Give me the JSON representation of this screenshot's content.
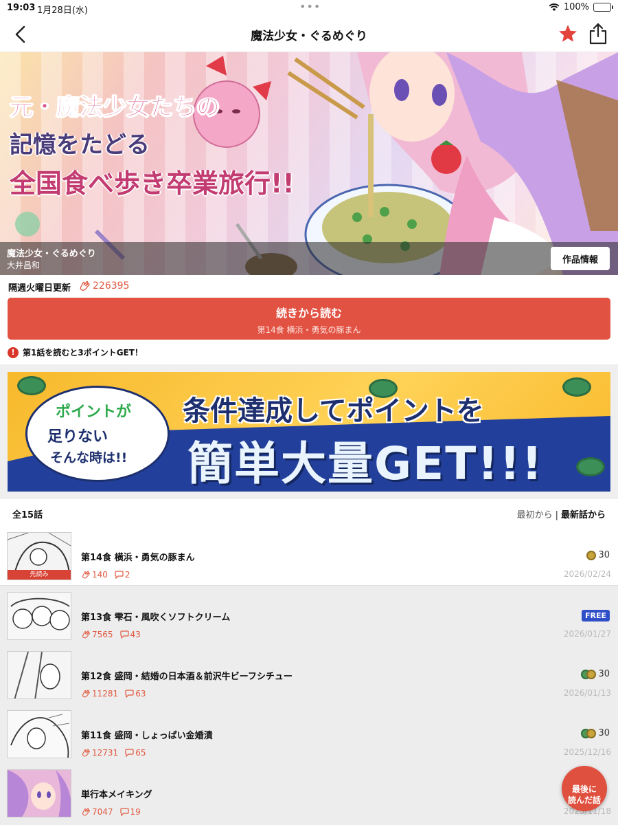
{
  "status": {
    "time": "19:03",
    "date": "1月28日(水)",
    "battery": "100%"
  },
  "nav": {
    "title": "魔法少女・ぐるめぐり"
  },
  "hero": {
    "catch_line1": "元・魔法少女たちの",
    "catch_line2": "記憶をたどる",
    "catch_line3": "全国食べ歩き卒業旅行!!",
    "title": "魔法少女・ぐるめぐり",
    "author": "大井昌和",
    "info_button": "作品情報"
  },
  "update": {
    "schedule": "隔週火曜日更新",
    "likes": "226395"
  },
  "continue": {
    "label": "続きから読む",
    "episode": "第14食 横浜・勇気の豚まん"
  },
  "notice": "第1話を読むと3ポイントGET！",
  "banner": {
    "bubble1": "ポイントが",
    "bubble2": "足りない",
    "bubble3": "そんな時は!!",
    "headline1": "条件達成してポイントを",
    "headline2": "簡単大量GET!!!"
  },
  "list": {
    "count": "全15話",
    "sort_oldest": "最初から",
    "sort_sep": "|",
    "sort_newest": "最新話から"
  },
  "episodes": [
    {
      "title": "第14食 横浜・勇気の豚まん",
      "likes": "140",
      "comments": "2",
      "price": "30",
      "date": "2026/02/24",
      "tag": "先読み"
    },
    {
      "title": "第13食 雫石・風吹くソフトクリーム",
      "likes": "7565",
      "comments": "43",
      "price": "FREE",
      "date": "2026/01/27"
    },
    {
      "title": "第12食 盛岡・結婚の日本酒＆前沢牛ビーフシチュー",
      "likes": "11281",
      "comments": "63",
      "price": "30",
      "date": "2026/01/13"
    },
    {
      "title": "第11食 盛岡・しょっぱい金婚漬",
      "likes": "12731",
      "comments": "65",
      "price": "30",
      "date": "2025/12/16"
    },
    {
      "title": "単行本メイキング",
      "likes": "7047",
      "comments": "19",
      "date": "2025/11/18"
    }
  ],
  "fab": {
    "line1": "最後に",
    "line2": "読んだ話"
  },
  "colors": {
    "accent": "#e25243",
    "free_badge": "#2f4fc9",
    "banner_blue": "#22409b",
    "banner_yellow": "#f7b92c"
  },
  "icons": {
    "back": "chevron-left-icon",
    "favorite": "star-icon",
    "share": "share-icon",
    "likes": "clap-icon",
    "comments": "comment-icon"
  }
}
